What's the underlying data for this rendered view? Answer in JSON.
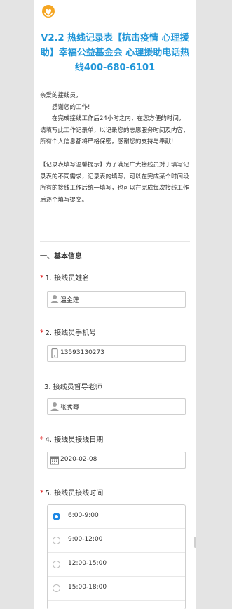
{
  "header": {
    "logo_icon": "heart-hands-logo",
    "title": "V2.2 热线记录表【抗击疫情 心理援助】幸福公益基金会 心理援助电话热线400-680-6101"
  },
  "intro": {
    "greeting": "亲爱的接线员，",
    "thanks": "感谢您的工作!",
    "instructions": "在完成接线工作后24小时之内，在您方便的时间，请填写此工作记录单，以记录您的志愿服务时间及内容，所有个人信息都将严格保密，感谢您的支持与奉献!",
    "tip": "【记录表填写温馨提示】为了满足广大接线员对于填写记录表的不同需求，记录表的填写，可以在完成某个时间段所有的接线工作后统一填写，也可以在完成每次接线工作后逐个填写提交。"
  },
  "section_title": "一、基本信息",
  "questions": [
    {
      "required": true,
      "label": "1. 接线员姓名",
      "icon": "person-icon",
      "value": "温金莲"
    },
    {
      "required": true,
      "label": "2. 接线员手机号",
      "icon": "phone-icon",
      "value": "13593130273"
    },
    {
      "required": false,
      "label": "3. 接线员督导老师",
      "icon": "person-icon",
      "value": "张秀琴"
    },
    {
      "required": true,
      "label": "4. 接线员接线日期",
      "icon": "calendar-icon",
      "value": "2020-02-08"
    },
    {
      "required": true,
      "label": "5. 接线员接线时间"
    }
  ],
  "required_mark": "*",
  "time_options": [
    {
      "label": "6:00-9:00",
      "selected": true
    },
    {
      "label": "9:00-12:00",
      "selected": false
    },
    {
      "label": "12:00-15:00",
      "selected": false
    },
    {
      "label": "15:00-18:00",
      "selected": false
    }
  ],
  "colors": {
    "accent": "#2196d8",
    "required": "#e02020",
    "radio_selected": "#1e88e5"
  }
}
